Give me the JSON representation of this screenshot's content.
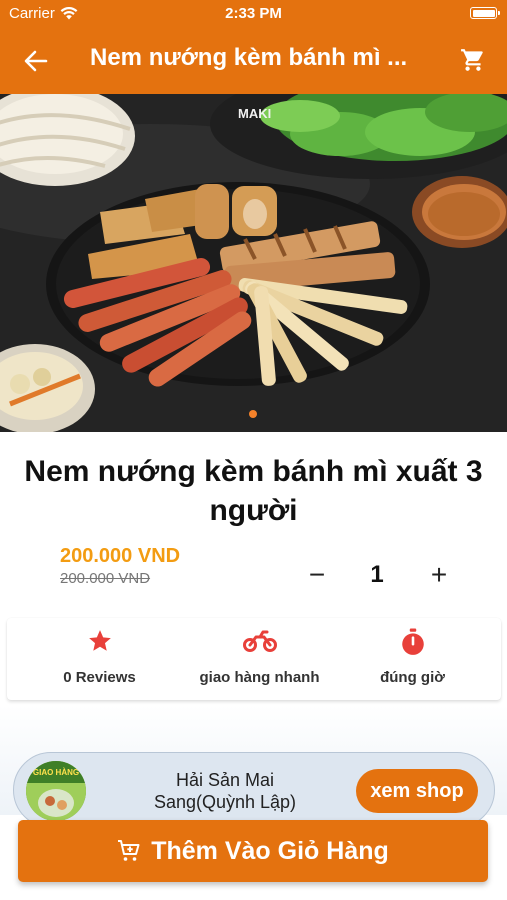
{
  "status_bar": {
    "carrier": "Carrier",
    "time": "2:33 PM"
  },
  "nav": {
    "title": "Nem nướng kèm bánh mì ...",
    "back_icon": "arrow-left-icon",
    "cart_icon": "shopping-cart-icon"
  },
  "hero": {
    "brand_mark": "MAKI",
    "slide_count": 1,
    "active_slide": 1
  },
  "product": {
    "title": "Nem nướng kèm bánh mì xuất 3 người",
    "price": "200.000 VND",
    "old_price": "200.000 VND",
    "quantity": "1",
    "minus_label": "−",
    "plus_label": "+"
  },
  "features": [
    {
      "icon": "star-icon",
      "label": "0 Reviews",
      "color": "#e8403a"
    },
    {
      "icon": "motorbike-icon",
      "label": "giao hàng nhanh",
      "color": "#e8403a"
    },
    {
      "icon": "stopwatch-icon",
      "label": "đúng giờ",
      "color": "#e8403a"
    }
  ],
  "shop": {
    "name": "Hải Sản Mai Sang(Quỳnh Lập)",
    "view_shop_label": "xem shop",
    "avatar_text": "GIAO HÀNG"
  },
  "add_to_cart": {
    "label": "Thêm Vào Giỏ Hàng",
    "icon": "cart-add-icon"
  },
  "colors": {
    "primary": "#e4720f",
    "price": "#f39c12",
    "icon_red": "#e8403a",
    "shop_card": "#dde6f0"
  }
}
